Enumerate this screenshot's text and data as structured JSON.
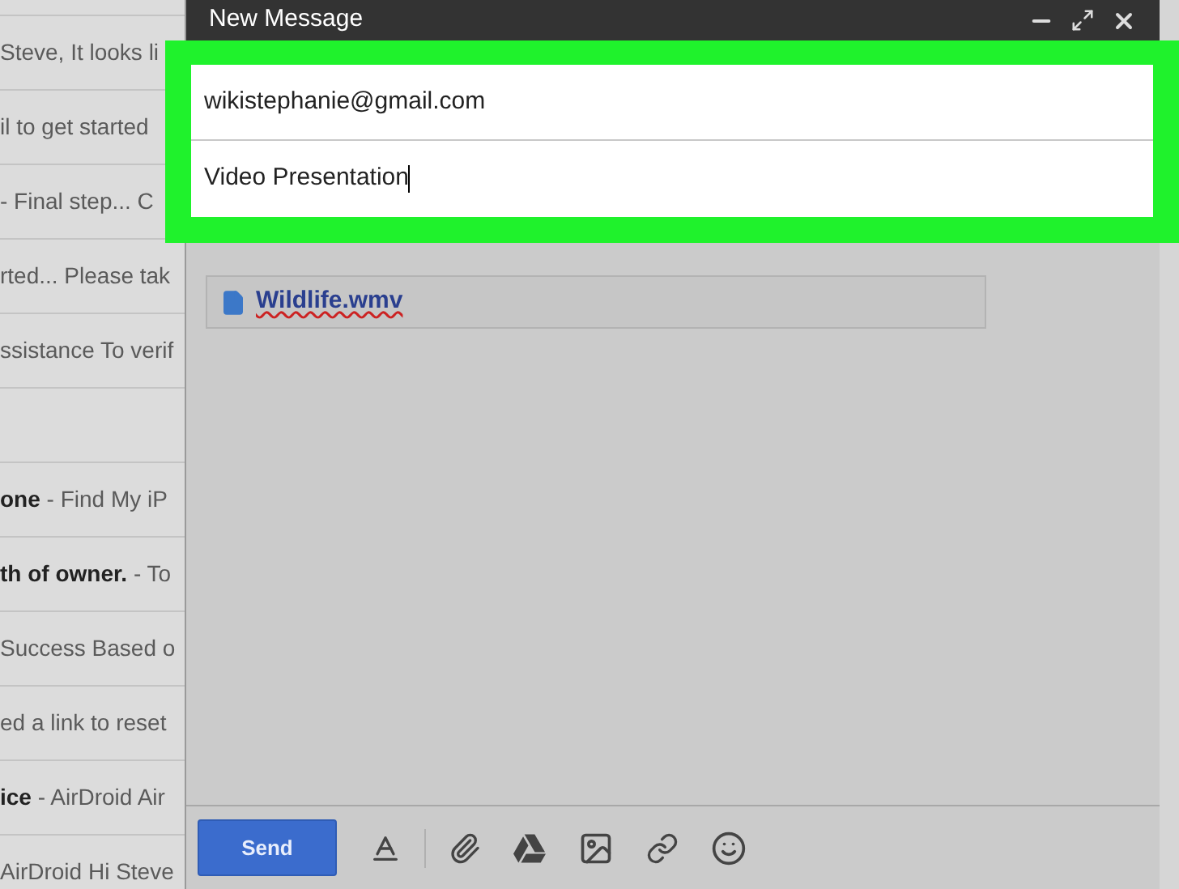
{
  "inbox_groups": [
    [
      {
        "text": "Steve, It looks li"
      },
      {
        "text": "il to get started"
      },
      {
        "text": "- Final step... C"
      },
      {
        "text": "rted... Please tak"
      },
      {
        "text": "ssistance To verif"
      }
    ],
    [
      {
        "text": "**one** - Find My iP"
      },
      {
        "text": "**th of owner.** - To"
      },
      {
        "text": "Success Based o"
      },
      {
        "text": "ed a link to reset"
      },
      {
        "text": "**ice** - AirDroid Air"
      },
      {
        "text": "AirDroid Hi Steve"
      }
    ]
  ],
  "compose": {
    "title": "New Message",
    "to": "wikistephanie@gmail.com",
    "subject": "Video Presentation",
    "attachment": "Wildlife.wmv",
    "send": "Send"
  }
}
